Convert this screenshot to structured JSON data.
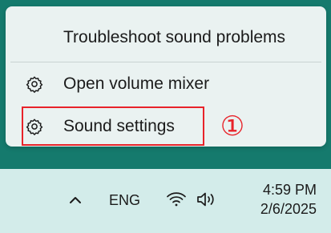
{
  "context_menu": {
    "items": [
      {
        "label": "Troubleshoot sound problems",
        "icon": null
      },
      {
        "label": "Open volume mixer",
        "icon": "gear-icon"
      },
      {
        "label": "Sound settings",
        "icon": "gear-icon"
      }
    ],
    "highlighted_item_index": 2
  },
  "annotation": {
    "callout_label": "①",
    "color": "#e8232a"
  },
  "taskbar": {
    "language": "ENG",
    "clock": {
      "time": "4:59 PM",
      "date": "2/6/2025"
    },
    "icons": [
      "chevron-up-icon",
      "wifi-icon",
      "volume-icon"
    ]
  },
  "colors": {
    "wallpaper": "#157a6d",
    "menu_background": "#eaf2f1",
    "taskbar_background": "#d3ecea",
    "highlight_border": "#e8232a"
  }
}
